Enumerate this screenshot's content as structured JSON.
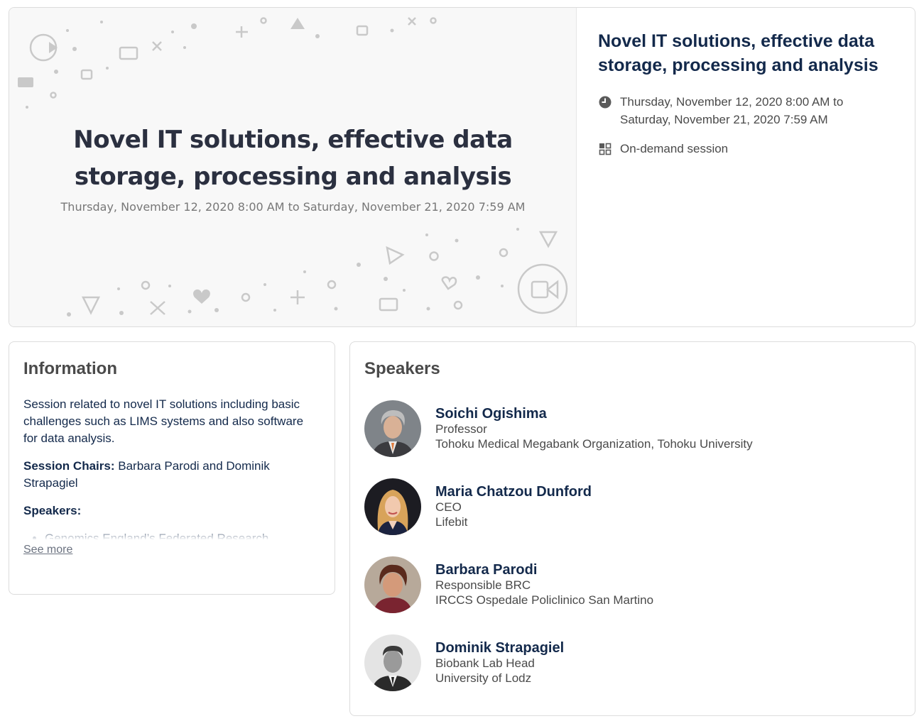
{
  "session": {
    "banner_title": "Novel IT solutions, effective data storage, processing and analysis",
    "banner_date": "Thursday, November 12, 2020 8:00 AM to Saturday, November 21, 2020 7:59 AM",
    "title": "Novel IT solutions, effective data storage, processing and analysis",
    "date_line1": "Thursday, November 12, 2020 8:00 AM to",
    "date_line2": "Saturday, November 21, 2020 7:59 AM",
    "type": "On-demand session",
    "icons": {
      "date": "clock-icon",
      "type": "grid-icon"
    }
  },
  "information": {
    "heading": "Information",
    "description": "Session related to novel IT solutions including basic challenges such as LIMS systems and also software for data analysis.",
    "chairs_label": "Session Chairs:",
    "chairs_value": "Barbara Parodi and Dominik Strapagiel",
    "speakers_label": "Speakers:",
    "speaker_items": [
      "Genomics England’s Federated Research Environment, part of the UK Government’s"
    ],
    "see_more": "See more"
  },
  "speakers": {
    "heading": "Speakers",
    "items": [
      {
        "name": "Soichi Ogishima",
        "title": "Professor",
        "org": "Tohoku Medical Megabank Organization, Tohoku University"
      },
      {
        "name": "Maria Chatzou Dunford",
        "title": "CEO",
        "org": "Lifebit"
      },
      {
        "name": "Barbara Parodi",
        "title": "Responsible BRC",
        "org": "IRCCS Ospedale Policlinico San Martino"
      },
      {
        "name": "Dominik Strapagiel",
        "title": "Biobank Lab Head",
        "org": "University of Lodz"
      }
    ]
  },
  "colors": {
    "heading": "#13294b",
    "muted": "#4a4a4a",
    "border": "#dcdcdc"
  }
}
